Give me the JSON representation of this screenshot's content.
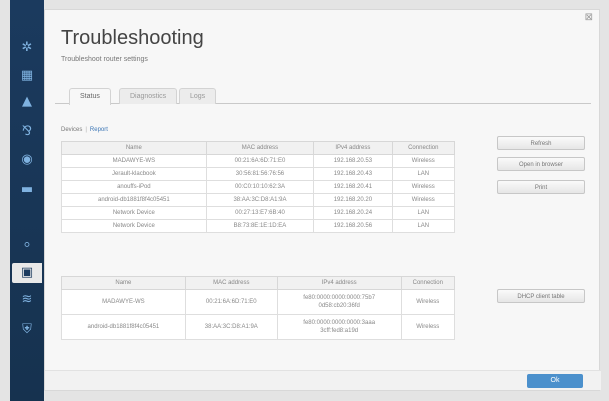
{
  "page": {
    "title": "Troubleshooting",
    "subtitle": "Troubleshoot router settings",
    "close_glyph": "⊠"
  },
  "sidebar": {
    "icons": [
      {
        "name": "network-map-icon",
        "glyph": "✲"
      },
      {
        "name": "devices-icon",
        "glyph": "▦"
      },
      {
        "name": "alert-icon",
        "glyph": "▲"
      },
      {
        "name": "parental-icon",
        "glyph": "⅋"
      },
      {
        "name": "media-icon",
        "glyph": "◉"
      },
      {
        "name": "speed-icon",
        "glyph": "▬"
      },
      {
        "name": "connectivity-icon",
        "glyph": "⸰"
      },
      {
        "name": "troubleshooting-icon",
        "glyph": "▣"
      },
      {
        "name": "wireless-icon",
        "glyph": "≋"
      },
      {
        "name": "security-icon",
        "glyph": "⛨"
      }
    ]
  },
  "tabs": [
    "Status",
    "Diagnostics",
    "Logs"
  ],
  "subnav": {
    "devices": "Devices",
    "report": "Report"
  },
  "table1": {
    "headers": [
      "Name",
      "MAC address",
      "IPv4 address",
      "Connection"
    ],
    "rows": [
      [
        "MADAWYE-WS",
        "00:21:6A:6D:71:E0",
        "192.168.20.53",
        "Wireless"
      ],
      [
        "Jerault-klacbook",
        "30:56:81:56:76:56",
        "192.168.20.43",
        "LAN"
      ],
      [
        "anouffs-iPod",
        "00:C0:10:10:62:3A",
        "192.168.20.41",
        "Wireless"
      ],
      [
        "android-db1881f8f4c05451",
        "38:AA:3C:D8:A1:9A",
        "192.168.20.20",
        "Wireless"
      ],
      [
        "Network Device",
        "00:27:13:E7:6B:40",
        "192.168.20.24",
        "LAN"
      ],
      [
        "Network Device",
        "B8:73:8E:1E:1D:EA",
        "192.168.20.56",
        "LAN"
      ]
    ]
  },
  "table2": {
    "headers": [
      "Name",
      "MAC address",
      "IPv4 address",
      "Connection"
    ],
    "rows": [
      [
        "MADAWYE-WS",
        "00:21:6A:6D:71:E0",
        "fe80:0000:0000:0000:75b7\n0d58:cb20:36fd",
        "Wireless"
      ],
      [
        "android-db1881f8f4c05451",
        "38:AA:3C:D8:A1:9A",
        "fe80:0000:0000:0000:3aaa\n3cff:fed8:a19d",
        "Wireless"
      ]
    ]
  },
  "buttons": {
    "refresh": "Refresh",
    "open_browser": "Open in browser",
    "print": "Print",
    "dhcp": "DHCP client table",
    "ok": "Ok"
  }
}
